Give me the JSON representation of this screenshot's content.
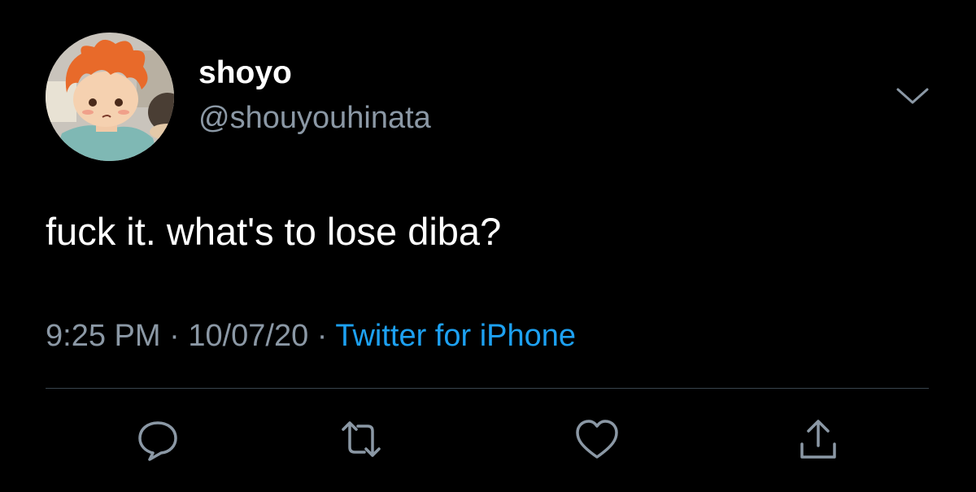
{
  "tweet": {
    "display_name": "shoyo",
    "handle": "@shouyouhinata",
    "text": "fuck it. what's to lose diba?",
    "time": "9:25 PM",
    "separator": "·",
    "date": "10/07/20",
    "source": "Twitter for iPhone"
  },
  "icons": {
    "menu": "chevron-down-icon",
    "reply": "reply-icon",
    "retweet": "retweet-icon",
    "like": "heart-icon",
    "share": "share-icon"
  },
  "colors": {
    "background": "#000000",
    "text_primary": "#ffffff",
    "text_secondary": "#8b98a5",
    "link": "#1da1f2",
    "divider": "#38444d"
  }
}
